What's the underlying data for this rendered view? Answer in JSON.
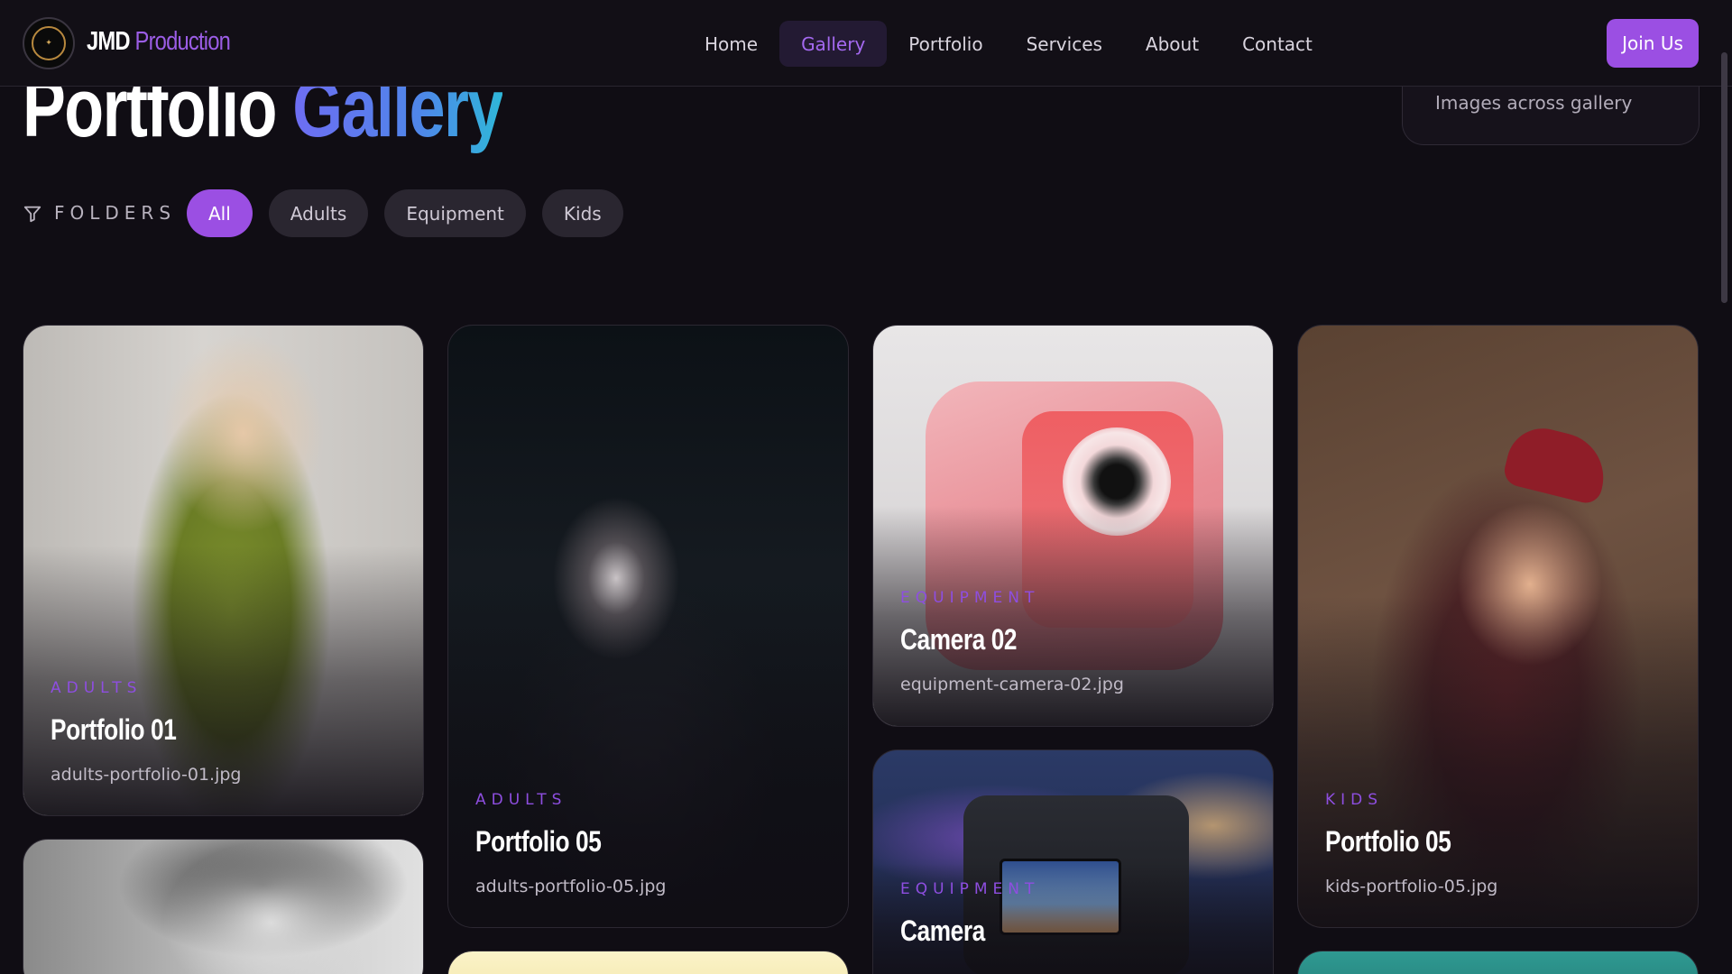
{
  "nav": {
    "brand_part1": "JMD",
    "brand_part2": "Production",
    "links": [
      "Home",
      "Gallery",
      "Portfolio",
      "Services",
      "About",
      "Contact"
    ],
    "active_link": "Gallery",
    "join_label": "Join Us"
  },
  "header": {
    "title_part1": "Portfolio",
    "title_part2": "Gallery",
    "stat_label": "Images across gallery"
  },
  "filters": {
    "label": "FOLDERS",
    "chips": [
      "All",
      "Adults",
      "Equipment",
      "Kids"
    ],
    "active_chip": "All"
  },
  "gallery": {
    "cards": [
      {
        "category": "ADULTS",
        "title": "Portfolio 01",
        "file": "adults-portfolio-01.jpg"
      },
      {
        "category": "ADULTS",
        "title": "Portfolio 05",
        "file": "adults-portfolio-05.jpg"
      },
      {
        "category": "EQUIPMENT",
        "title": "Camera 02",
        "file": "equipment-camera-02.jpg"
      },
      {
        "category": "KIDS",
        "title": "Portfolio 05",
        "file": "kids-portfolio-05.jpg"
      },
      {
        "category": "EQUIPMENT",
        "title": "Camera",
        "file": ""
      }
    ]
  },
  "colors": {
    "accent": "#9b4fe3",
    "background": "#100d14",
    "title_gradient_start": "#6e6df2",
    "title_gradient_end": "#2fb7d9"
  }
}
